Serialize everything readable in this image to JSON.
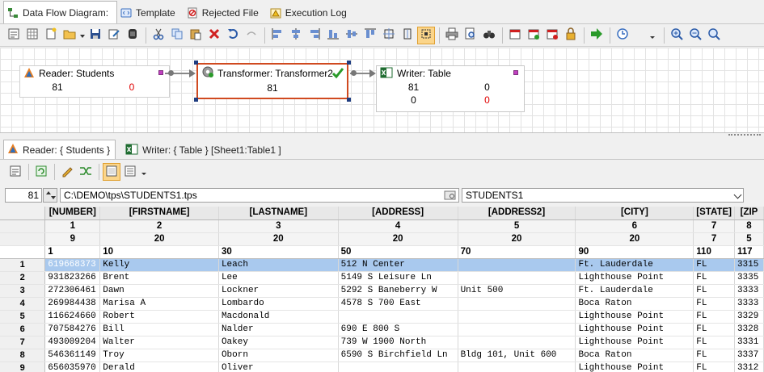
{
  "tabs": [
    {
      "label": "Data Flow Diagram:",
      "icon": "diagram-icon",
      "active": true
    },
    {
      "label": "Template",
      "icon": "template-icon",
      "active": false
    },
    {
      "label": "Rejected File",
      "icon": "rejected-file-icon",
      "active": false
    },
    {
      "label": "Execution Log",
      "icon": "warning-log-icon",
      "active": false
    }
  ],
  "diagram": {
    "reader": {
      "title": "Reader: Students",
      "count": "81",
      "errors": "0"
    },
    "transformer": {
      "title": "Transformer: Transformer2",
      "count": "81"
    },
    "writer": {
      "title": "Writer: Table",
      "r1c1": "81",
      "r1c2": "0",
      "r2c1": "0",
      "r2c2": "0"
    }
  },
  "bottom_tabs": [
    {
      "label": "Reader: { Students }",
      "active": true
    },
    {
      "label": "Writer: { Table } [Sheet1:Table1 ]",
      "active": false
    }
  ],
  "navigator": {
    "record": "81",
    "path": "C:\\DEMO\\tps\\STUDENTS1.tps",
    "table": "STUDENTS1"
  },
  "grid": {
    "columns": [
      {
        "name": "[NUMBER]",
        "idx": "1",
        "len": "9",
        "pos": "1"
      },
      {
        "name": "[FIRSTNAME]",
        "idx": "2",
        "len": "20",
        "pos": "10"
      },
      {
        "name": "[LASTNAME]",
        "idx": "3",
        "len": "20",
        "pos": "30"
      },
      {
        "name": "[ADDRESS]",
        "idx": "4",
        "len": "20",
        "pos": "50"
      },
      {
        "name": "[ADDRESS2]",
        "idx": "5",
        "len": "20",
        "pos": "70"
      },
      {
        "name": "[CITY]",
        "idx": "6",
        "len": "20",
        "pos": "90"
      },
      {
        "name": "[STATE]",
        "idx": "7",
        "len": "7",
        "pos": "110"
      },
      {
        "name": "[ZIP",
        "idx": "8",
        "len": "5",
        "pos": "117"
      }
    ],
    "rows": [
      {
        "n": "1",
        "cells": [
          "619668373",
          "Kelly",
          "Leach",
          "512 N Center",
          "",
          "Ft. Lauderdale",
          "FL",
          "3315"
        ]
      },
      {
        "n": "2",
        "cells": [
          "931823266",
          "Brent",
          "Lee",
          "5149 S Leisure Ln",
          "",
          "Lighthouse Point",
          "FL",
          "3335"
        ]
      },
      {
        "n": "3",
        "cells": [
          "272306461",
          "Dawn",
          "Lockner",
          "5292 S Baneberry W",
          "Unit 500",
          "Ft. Lauderdale",
          "FL",
          "3333"
        ]
      },
      {
        "n": "4",
        "cells": [
          "269984438",
          "Marisa A",
          "Lombardo",
          "4578 S 700 East",
          "",
          "Boca Raton",
          "FL",
          "3333"
        ]
      },
      {
        "n": "5",
        "cells": [
          "116624660",
          "Robert",
          "Macdonald",
          "",
          "",
          "Lighthouse Point",
          "FL",
          "3329"
        ]
      },
      {
        "n": "6",
        "cells": [
          "707584276",
          "Bill",
          "Nalder",
          "690 E 800 S",
          "",
          "Lighthouse Point",
          "FL",
          "3328"
        ]
      },
      {
        "n": "7",
        "cells": [
          "493009204",
          "Walter",
          "Oakey",
          "739 W 1900 North",
          "",
          "Lighthouse Point",
          "FL",
          "3331"
        ]
      },
      {
        "n": "8",
        "cells": [
          "546361149",
          "Troy",
          "Oborn",
          "6590 S Birchfield Ln",
          "Bldg 101, Unit 600",
          "Boca Raton",
          "FL",
          "3337"
        ]
      },
      {
        "n": "9",
        "cells": [
          "656035970",
          "Derald",
          "Oliver",
          "",
          "",
          "Lighthouse Point",
          "FL",
          "3312"
        ]
      }
    ]
  }
}
